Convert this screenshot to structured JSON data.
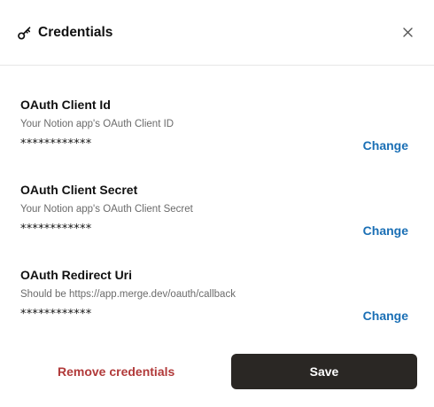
{
  "header": {
    "title": "Credentials",
    "icon": "key-icon",
    "close_icon": "close-icon"
  },
  "fields": [
    {
      "label": "OAuth Client Id",
      "hint": "Your Notion app's OAuth Client ID",
      "value": "************",
      "action": "Change"
    },
    {
      "label": "OAuth Client Secret",
      "hint": "Your Notion app's OAuth Client Secret",
      "value": "************",
      "action": "Change"
    },
    {
      "label": "OAuth Redirect Uri",
      "hint": "Should be https://app.merge.dev/oauth/callback",
      "value": "************",
      "action": "Change"
    }
  ],
  "footer": {
    "remove_label": "Remove credentials",
    "save_label": "Save"
  },
  "colors": {
    "link": "#1a6fb5",
    "danger": "#b13a3a",
    "primary_button": "#2a2724"
  }
}
